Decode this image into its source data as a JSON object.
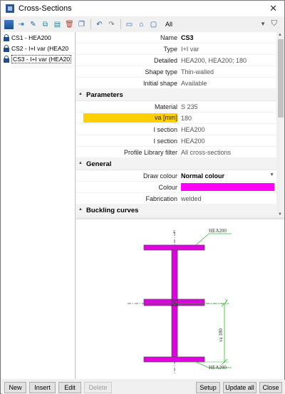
{
  "window": {
    "title": "Cross-Sections",
    "close_label": "✕"
  },
  "toolbar": {
    "filter_label": "All"
  },
  "sections_list": [
    {
      "label": "CS1 - HEA200"
    },
    {
      "label": "CS2 - I+I var (HEA20"
    },
    {
      "label": "CS3 - I+I var (HEA20"
    }
  ],
  "props": {
    "top": [
      {
        "label": "Name",
        "value": "CS3"
      },
      {
        "label": "Type",
        "value": "I+I var"
      },
      {
        "label": "Detailed",
        "value": "HEA200, HEA200; 180"
      },
      {
        "label": "Shape type",
        "value": "Thin-walled"
      },
      {
        "label": "Initial shape",
        "value": "Available"
      }
    ],
    "parameters": {
      "title": "Parameters",
      "rows": [
        {
          "label": "Material",
          "value": "S 235"
        },
        {
          "label": "va [mm]",
          "value": "180"
        },
        {
          "label": "I section",
          "value": "HEA200"
        },
        {
          "label": "I section",
          "value": "HEA200"
        },
        {
          "label": "Profile Library filter",
          "value": "All cross-sections"
        }
      ]
    },
    "general": {
      "title": "General",
      "draw_colour_label": "Draw colour",
      "draw_colour_value": "Normal colour",
      "colour_label": "Colour",
      "colour_hex": "#ff00ff",
      "fabrication_label": "Fabrication",
      "fabrication_value": "welded"
    },
    "buckling": {
      "title": "Buckling curves"
    }
  },
  "preview": {
    "z_label": "z",
    "y_label": "y",
    "top_profile": "HEA200",
    "bottom_profile": "HEA200",
    "dim_label": "va 180",
    "section_color": "#e000e0",
    "dim_color": "#2db92d"
  },
  "buttons": {
    "new": "New",
    "insert": "Insert",
    "edit": "Edit",
    "delete": "Delete",
    "setup": "Setup",
    "update_all": "Update all",
    "close": "Close"
  }
}
